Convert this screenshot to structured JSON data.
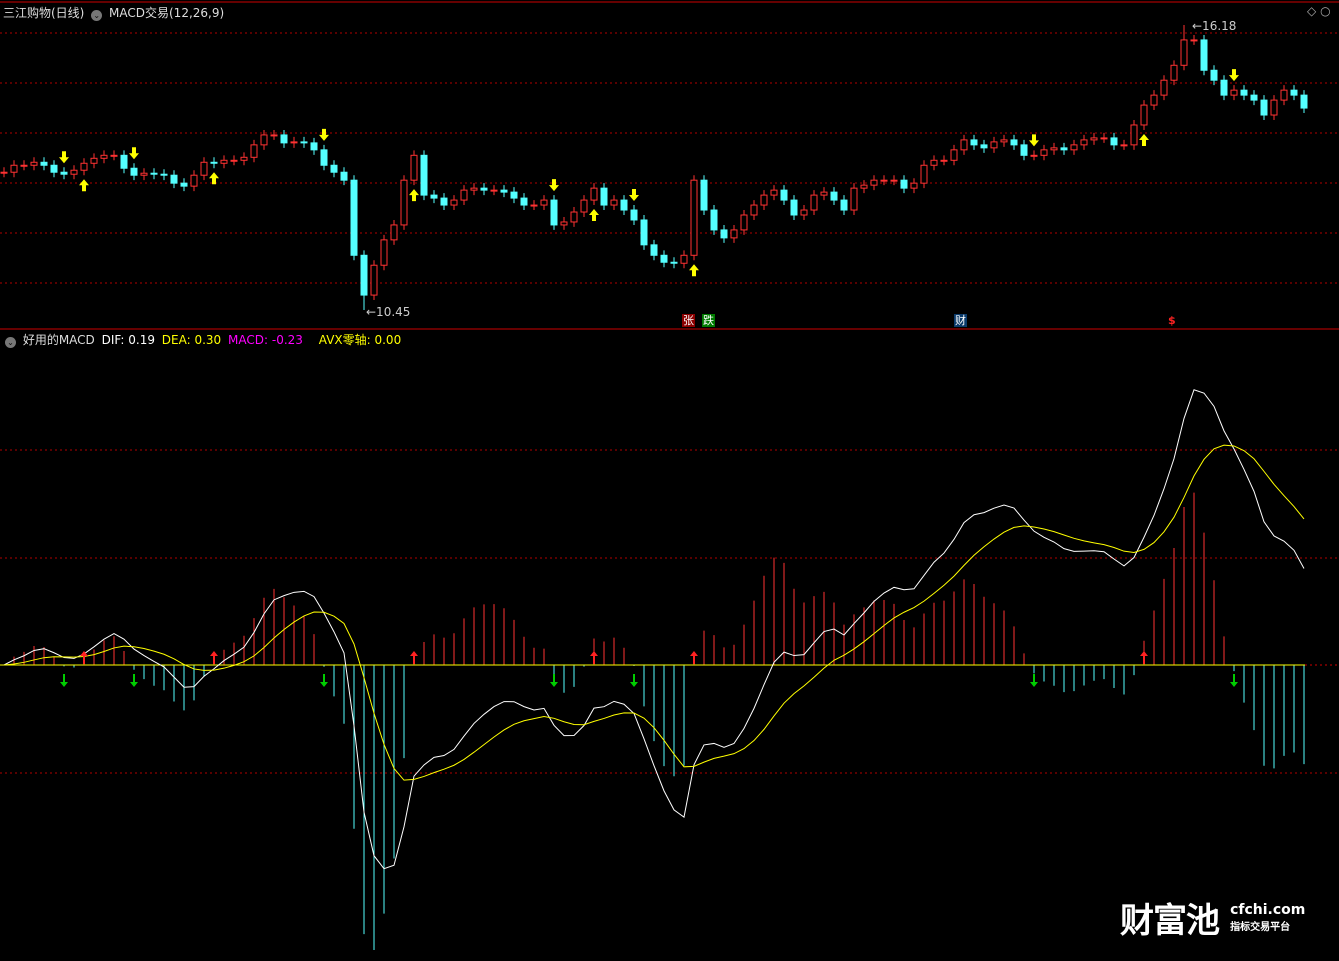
{
  "header": {
    "stock": "三江购物(日线)",
    "indicator": "MACD交易(12,26,9)"
  },
  "macd_header": {
    "name": "好用的MACD",
    "dif": "DIF: 0.19",
    "dea": "DEA: 0.30",
    "macd": "MACD: -0.23",
    "avx": "AVX零轴: 0.00"
  },
  "badges": {
    "zhang": "张",
    "die": "跌",
    "cai": "财",
    "dollar": "$"
  },
  "logo": {
    "brand": "财富池",
    "domain": "cfchi.com",
    "tagline": "指标交易平台"
  },
  "colors": {
    "up": "#ff3232",
    "down": "#54ffff",
    "grid": "#b00000",
    "dif": "#ffffff",
    "dea": "#ffff00",
    "arrow": "#ffff00"
  },
  "chart_data": {
    "type": "candlestick",
    "price_max_label": "16.18",
    "price_min_label": "10.45",
    "price_range": [
      10.45,
      16.18
    ],
    "closes": [
      13.22,
      13.36,
      13.36,
      13.42,
      13.36,
      13.22,
      13.18,
      13.26,
      13.4,
      13.5,
      13.56,
      13.56,
      13.3,
      13.16,
      13.2,
      13.18,
      13.16,
      13.0,
      12.94,
      13.16,
      13.42,
      13.4,
      13.46,
      13.46,
      13.52,
      13.77,
      13.97,
      13.97,
      13.81,
      13.83,
      13.81,
      13.67,
      13.36,
      13.22,
      13.06,
      11.55,
      10.75,
      11.35,
      11.86,
      12.16,
      13.06,
      13.56,
      12.76,
      12.7,
      12.56,
      12.66,
      12.86,
      12.9,
      12.86,
      12.86,
      12.82,
      12.7,
      12.56,
      12.56,
      12.66,
      12.16,
      12.22,
      12.42,
      12.66,
      12.9,
      12.56,
      12.66,
      12.46,
      12.26,
      11.76,
      11.55,
      11.41,
      11.39,
      11.55,
      13.06,
      12.46,
      12.06,
      11.9,
      12.06,
      12.36,
      12.56,
      12.76,
      12.86,
      12.66,
      12.36,
      12.46,
      12.76,
      12.82,
      12.66,
      12.46,
      12.9,
      12.96,
      13.06,
      13.06,
      13.06,
      12.9,
      13.0,
      13.36,
      13.46,
      13.46,
      13.67,
      13.87,
      13.77,
      13.71,
      13.83,
      13.87,
      13.77,
      13.56,
      13.56,
      13.67,
      13.71,
      13.67,
      13.77,
      13.87,
      13.91,
      13.91,
      13.77,
      13.77,
      14.17,
      14.57,
      14.77,
      15.07,
      15.37,
      15.88,
      15.88,
      15.27,
      15.07,
      14.77,
      14.87,
      14.77,
      14.67,
      14.37,
      14.67,
      14.87,
      14.77,
      14.51
    ],
    "macd_params": [
      12,
      26,
      9
    ]
  }
}
